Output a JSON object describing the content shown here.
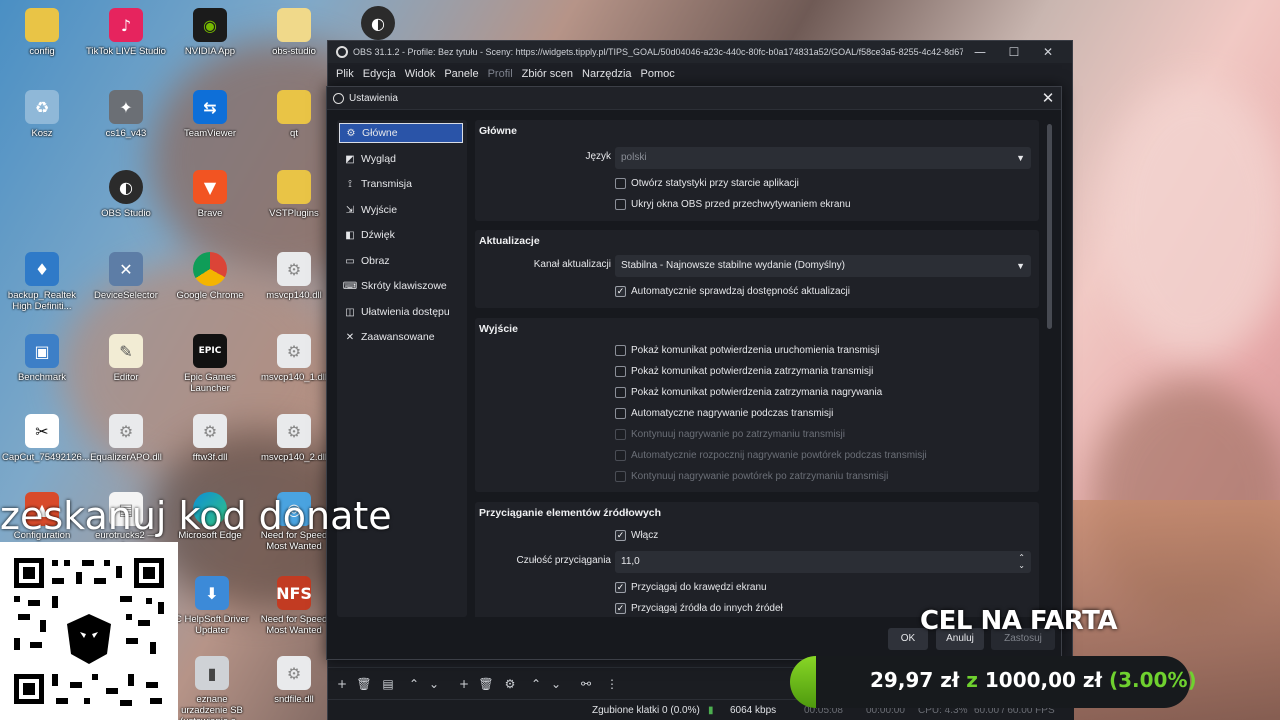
{
  "desktop": {
    "icons": [
      {
        "label": "config",
        "icon": "folder-icon"
      },
      {
        "label": "TikTok LIVE Studio",
        "icon": "tiktok-icon"
      },
      {
        "label": "NVIDIA App",
        "icon": "nvidia-icon"
      },
      {
        "label": "obs-studio",
        "icon": "folder-icon"
      },
      {
        "label": "Kosz",
        "icon": "recycle-bin-icon"
      },
      {
        "label": "cs16_v43",
        "icon": "cs-icon"
      },
      {
        "label": "TeamViewer",
        "icon": "teamviewer-icon"
      },
      {
        "label": "qt",
        "icon": "folder-icon"
      },
      {
        "label": "OBS Studio",
        "icon": "obs-icon"
      },
      {
        "label": "Brave",
        "icon": "brave-icon"
      },
      {
        "label": "VSTPlugins",
        "icon": "folder-icon"
      },
      {
        "label": "backup_Realtek High Definiti...",
        "icon": "realtek-icon"
      },
      {
        "label": "DeviceSelector",
        "icon": "tools-icon"
      },
      {
        "label": "Google Chrome",
        "icon": "chrome-icon"
      },
      {
        "label": "msvcp140.dll",
        "icon": "dll-file-icon"
      },
      {
        "label": "Benchmark",
        "icon": "app-icon"
      },
      {
        "label": "Editor",
        "icon": "editor-icon"
      },
      {
        "label": "Epic Games Launcher",
        "icon": "epic-games-icon"
      },
      {
        "label": "msvcp140_1.dll",
        "icon": "dll-file-icon"
      },
      {
        "label": "CapCut_75492126...",
        "icon": "capcut-icon"
      },
      {
        "label": "EqualizerAPO.dll",
        "icon": "dll-file-icon"
      },
      {
        "label": "fftw3f.dll",
        "icon": "dll-file-icon"
      },
      {
        "label": "msvcp140_2.dll",
        "icon": "dll-file-icon"
      },
      {
        "label": "Configuration",
        "icon": "app-icon"
      },
      {
        "label": "eurotrucks2 — sk...",
        "icon": "file-icon"
      },
      {
        "label": "Microsoft Edge",
        "icon": "edge-icon"
      },
      {
        "label": "Need for Speed Most Wanted",
        "icon": "nfs-icon"
      },
      {
        "label": "C HelpSoft Driver Updater",
        "icon": "driver-updater-icon"
      },
      {
        "label": "Need for Speed Most Wanted",
        "icon": "nfs-icon"
      },
      {
        "label": "eznane urzadzenie SB (ustawianie a...",
        "icon": "usb-device-icon"
      },
      {
        "label": "sndfile.dll",
        "icon": "dll-file-icon"
      }
    ]
  },
  "obs": {
    "title": "OBS 31.1.2 - Profile: Bez tytułu - Sceny: https://widgets.tipply.pl/TIPS_GOAL/50d04046-a23c-440c-80fc-b0a174831a52/GOAL/f58ce3a5-8255-4c42-8d67-b28...",
    "menu": [
      "Plik",
      "Edycja",
      "Widok",
      "Panele",
      "Profil",
      "Zbiór scen",
      "Narzędzia",
      "Pomoc"
    ],
    "status": {
      "dropped": "Zgubione klatki 0 (0.0%)",
      "bitrate": "6064 kbps",
      "time1": "00:05:08",
      "time2": "00:00:00",
      "cpu": "CPU: 4.3%",
      "fps": "60.00 / 60.00 FPS"
    }
  },
  "settings": {
    "title": "Ustawienia",
    "nav": [
      {
        "label": "Główne",
        "icon": "gear-icon",
        "active": true
      },
      {
        "label": "Wygląd",
        "icon": "palette-icon",
        "active": false
      },
      {
        "label": "Transmisja",
        "icon": "broadcast-icon",
        "active": false
      },
      {
        "label": "Wyjście",
        "icon": "output-icon",
        "active": false
      },
      {
        "label": "Dźwięk",
        "icon": "speaker-icon",
        "active": false
      },
      {
        "label": "Obraz",
        "icon": "monitor-icon",
        "active": false
      },
      {
        "label": "Skróty klawiszowe",
        "icon": "keyboard-icon",
        "active": false
      },
      {
        "label": "Ułatwienia dostępu",
        "icon": "accessibility-icon",
        "active": false
      },
      {
        "label": "Zaawansowane",
        "icon": "wrench-icon",
        "active": false
      }
    ],
    "general": {
      "title": "Główne",
      "language_label": "Język",
      "language_value": "polski",
      "open_stats": "Otwórz statystyki przy starcie aplikacji",
      "hide_windows": "Ukryj okna OBS przed przechwytywaniem ekranu"
    },
    "updates": {
      "title": "Aktualizacje",
      "channel_label": "Kanał aktualizacji",
      "channel_value": "Stabilna - Najnowsze stabilne wydanie (Domyślny)",
      "auto_check": "Automatycznie sprawdzaj dostępność aktualizacji"
    },
    "output": {
      "title": "Wyjście",
      "items": [
        {
          "label": "Pokaż komunikat potwierdzenia uruchomienia transmisji",
          "checked": false,
          "disabled": false
        },
        {
          "label": "Pokaż komunikat potwierdzenia zatrzymania transmisji",
          "checked": false,
          "disabled": false
        },
        {
          "label": "Pokaż komunikat potwierdzenia zatrzymania nagrywania",
          "checked": false,
          "disabled": false
        },
        {
          "label": "Automatyczne nagrywanie podczas transmisji",
          "checked": false,
          "disabled": false
        },
        {
          "label": "Kontynuuj nagrywanie po zatrzymaniu transmisji",
          "checked": false,
          "disabled": true
        },
        {
          "label": "Automatycznie rozpocznij nagrywanie powtórek podczas transmisji",
          "checked": false,
          "disabled": true
        },
        {
          "label": "Kontynuuj nagrywanie powtórek po zatrzymaniu transmisji",
          "checked": false,
          "disabled": true
        }
      ]
    },
    "snapping": {
      "title": "Przyciąganie elementów źródłowych",
      "enable": "Włącz",
      "sensitivity_label": "Czułość przyciągania",
      "sensitivity_value": "11,0",
      "snap_edges": "Przyciągaj do krawędzi ekranu",
      "snap_sources": "Przyciągaj źródła do innych źródeł"
    },
    "buttons": {
      "ok": "OK",
      "cancel": "Anuluj",
      "apply": "Zastosuj"
    }
  },
  "overlay": {
    "scan_text": "zeskanuj kod donate",
    "goal_title": "CEL NA FARTA",
    "goal_current": "29,97 zł",
    "goal_sep": "z",
    "goal_target": "1000,00 zł",
    "goal_percent": "(3.00%)",
    "goal_progress": 0.03
  }
}
